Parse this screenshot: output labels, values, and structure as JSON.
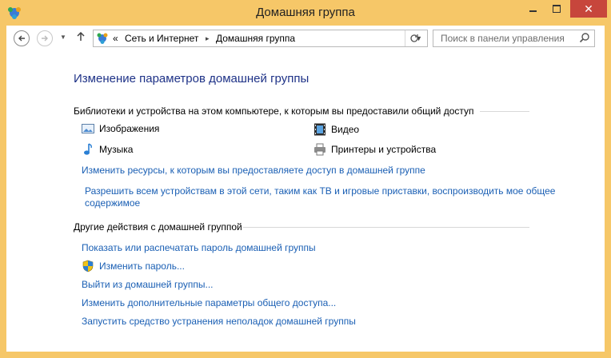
{
  "window": {
    "title": "Домашняя группа",
    "close_glyph": "✕"
  },
  "address": {
    "crumb_prefix": "«",
    "crumbs": [
      "Сеть и Интернет",
      "Домашняя группа"
    ],
    "separator": "▸",
    "search_placeholder": "Поиск в панели управления"
  },
  "main": {
    "heading": "Изменение параметров домашней группы",
    "libraries_section": "Библиотеки и устройства на этом компьютере, к которым вы предоставили общий доступ",
    "libraries": [
      {
        "label": "Изображения",
        "icon": "pictures-icon"
      },
      {
        "label": "Видео",
        "icon": "video-icon"
      },
      {
        "label": "Музыка",
        "icon": "music-icon"
      },
      {
        "label": "Принтеры и устройства",
        "icon": "printer-icon"
      }
    ],
    "change_resources_link": "Изменить ресурсы, к которым вы предоставляете доступ в домашней группе",
    "allow_devices_link": "Разрешить всем устройствам в этой сети, таким как ТВ и игровые приставки, воспроизводить мое общее содержимое",
    "other_section": "Другие действия с домашней группой",
    "actions": [
      "Показать или распечатать пароль домашней группы",
      "Изменить пароль...",
      "Выйти из домашней группы...",
      "Изменить дополнительные параметры общего доступа...",
      "Запустить средство устранения неполадок домашней группы"
    ]
  },
  "colors": {
    "frame": "#f6c768",
    "link": "#1a5fb4",
    "heading": "#1e3287",
    "close": "#c7463c"
  }
}
